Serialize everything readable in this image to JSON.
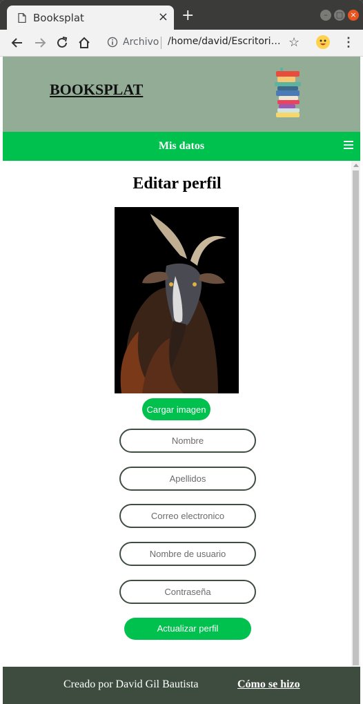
{
  "browser": {
    "tab_title": "Booksplat",
    "tab_close": "×",
    "new_tab": "+",
    "security_label": "Archivo",
    "url": "/home/david/Escritorio...",
    "window_controls": {
      "minimize": "–",
      "maximize": "□",
      "close": "×"
    }
  },
  "header": {
    "brand": "BOOKSPLAT",
    "logo_icon": "book-stack-icon"
  },
  "nav": {
    "title": "Mis datos",
    "menu_icon": "hamburger-icon"
  },
  "main": {
    "title": "Editar perfil",
    "profile_image": "goat-photo",
    "upload_button": "Cargar imagen",
    "fields": {
      "nombre": "Nombre",
      "apellidos": "Apellidos",
      "correo": "Correo electronico",
      "usuario": "Nombre de usuario",
      "contrasena": "Contraseña"
    },
    "submit_button": "Actualizar perfil"
  },
  "footer": {
    "credit": "Creado por David Gil Bautista",
    "link": "Cómo se hizo"
  },
  "colors": {
    "header_bg": "#93ac96",
    "nav_bg": "#00c04e",
    "footer_bg": "#3e4c40",
    "accent": "#00c04e"
  }
}
